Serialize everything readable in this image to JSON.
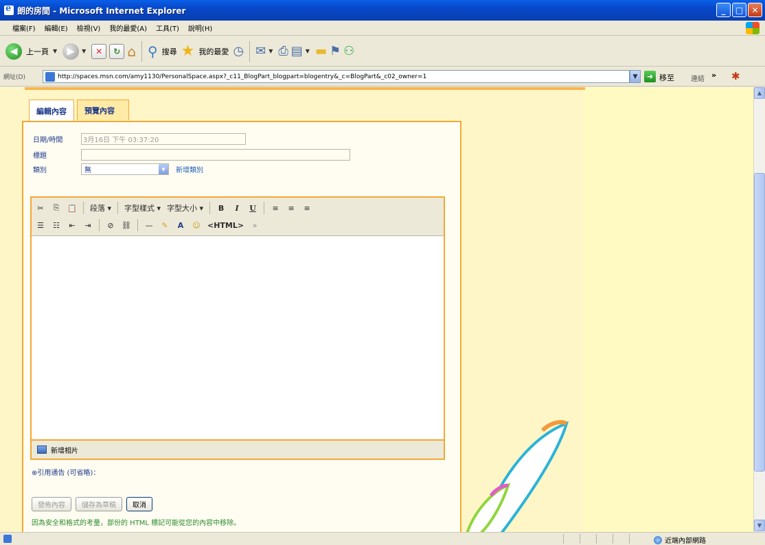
{
  "window": {
    "title": "朗的房間 - Microsoft Internet Explorer",
    "minimize": "_",
    "maximize": "□",
    "close": "✕"
  },
  "menu": [
    "檔案(F)",
    "編輯(E)",
    "檢視(V)",
    "我的最愛(A)",
    "工具(T)",
    "說明(H)"
  ],
  "toolbar": {
    "back_label": "上一頁",
    "search_label": "搜尋",
    "favorites_label": "我的最愛"
  },
  "address": {
    "label": "網址(D)",
    "url": "http://spaces.msn.com/amy1130/PersonalSpace.aspx?_c11_BlogPart_blogpart=blogentry&_c=BlogPart&_c02_owner=1",
    "go_label": "移至",
    "links_label": "連結",
    "links_more": "»"
  },
  "tabs": {
    "edit": "編輯內容",
    "preview": "預覽內容"
  },
  "form": {
    "date_label": "日期/時間",
    "date_value": "3月16日 下午 03:37:20",
    "title_label": "標題",
    "title_value": "",
    "category_label": "類別",
    "category_value": "無",
    "new_category_link": "新增類別"
  },
  "rte": {
    "row1": [
      "✂",
      "⎘",
      "📋",
      "段落 ▾",
      "字型樣式 ▾",
      "字型大小 ▾",
      "B",
      "I",
      "U",
      "≡",
      "≡",
      "≡"
    ],
    "row2": [
      "☰",
      "☷",
      "⇤",
      "⇥",
      "⊘",
      "⛓",
      "—",
      "✎",
      "A",
      "☺",
      "<HTML>",
      "»"
    ],
    "paragraph": "段落 ▾",
    "font_style": "字型樣式 ▾",
    "font_size": "字型大小 ▾",
    "html": "<HTML>"
  },
  "photo_bar": {
    "label": "新增相片"
  },
  "trackback": "⊕引用通告 (可省略)：",
  "buttons": {
    "publish": "發佈內容",
    "save_draft": "儲存為草稿",
    "cancel": "取消"
  },
  "notice": "因為安全和格式的考量，部份的 HTML 標記可能從您的內容中移除。",
  "status": {
    "zone": "近端內部網路"
  },
  "colors": {
    "accent_orange": "#F5A733",
    "page_bg": "#FFF6C7",
    "link_blue": "#1F5FB5",
    "notice_green": "#2A8A2A"
  }
}
